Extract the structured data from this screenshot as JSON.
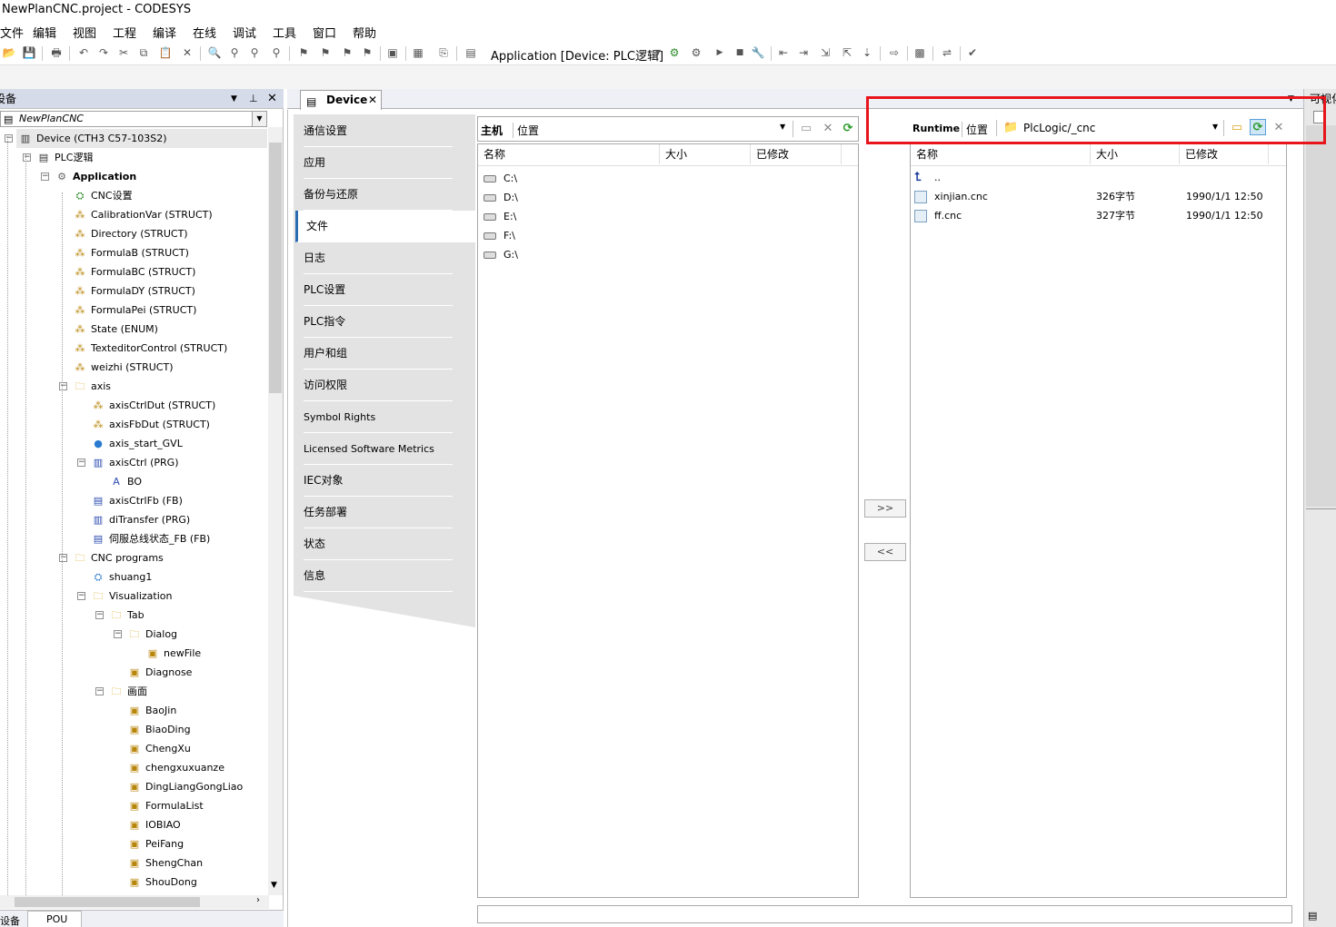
{
  "window": {
    "title": "NewPlanCNC.project - CODESYS"
  },
  "menu": [
    "文件",
    "编辑",
    "视图",
    "工程",
    "编译",
    "在线",
    "调试",
    "工具",
    "窗口",
    "帮助"
  ],
  "toolbar": {
    "active_application": "Application [Device: PLC逻辑]"
  },
  "left_panel": {
    "title": "设备",
    "project_combo": "NewPlanCNC",
    "tree": [
      {
        "label": "Device (CTH3 C57-103S2)",
        "icon": "device-icon",
        "level": 0
      },
      {
        "label": "PLC逻辑",
        "icon": "plc-logic-icon",
        "level": 1
      },
      {
        "label": "Application",
        "icon": "application-gear-icon",
        "level": 2
      },
      {
        "label": "CNC设置",
        "icon": "cnc-settings-icon",
        "level": 3
      },
      {
        "label": "CalibrationVar (STRUCT)",
        "icon": "struct-icon",
        "level": 3
      },
      {
        "label": "Directory (STRUCT)",
        "icon": "struct-icon",
        "level": 3
      },
      {
        "label": "FormulaB (STRUCT)",
        "icon": "struct-icon",
        "level": 3
      },
      {
        "label": "FormulaBC (STRUCT)",
        "icon": "struct-icon",
        "level": 3
      },
      {
        "label": "FormulaDY (STRUCT)",
        "icon": "struct-icon",
        "level": 3
      },
      {
        "label": "FormulaPei (STRUCT)",
        "icon": "struct-icon",
        "level": 3
      },
      {
        "label": "State (ENUM)",
        "icon": "enum-icon",
        "level": 3
      },
      {
        "label": "TexteditorControl (STRUCT)",
        "icon": "struct-icon",
        "level": 3
      },
      {
        "label": "weizhi (STRUCT)",
        "icon": "struct-icon",
        "level": 3
      },
      {
        "label": "axis",
        "icon": "folder-icon",
        "level": 3
      },
      {
        "label": "axisCtrlDut (STRUCT)",
        "icon": "struct-icon",
        "level": 4
      },
      {
        "label": "axisFbDut (STRUCT)",
        "icon": "struct-icon",
        "level": 4
      },
      {
        "label": "axis_start_GVL",
        "icon": "gvl-globe-icon",
        "level": 4
      },
      {
        "label": "axisCtrl (PRG)",
        "icon": "program-icon",
        "level": 4
      },
      {
        "label": "BO",
        "icon": "action-icon",
        "level": 5
      },
      {
        "label": "axisCtrlFb (FB)",
        "icon": "function-block-icon",
        "level": 4
      },
      {
        "label": "diTransfer (PRG)",
        "icon": "program-icon",
        "level": 4
      },
      {
        "label": "伺服总线状态_FB (FB)",
        "icon": "function-block-icon",
        "level": 4
      },
      {
        "label": "CNC programs",
        "icon": "folder-icon",
        "level": 3
      },
      {
        "label": "shuang1",
        "icon": "cnc-program-icon",
        "level": 4
      },
      {
        "label": "Visualization",
        "icon": "folder-icon",
        "level": 4
      },
      {
        "label": "Tab",
        "icon": "folder-icon",
        "level": 5
      },
      {
        "label": "Dialog",
        "icon": "folder-icon",
        "level": 6
      },
      {
        "label": "newFile",
        "icon": "visualization-icon",
        "level": 7
      },
      {
        "label": "Diagnose",
        "icon": "visualization-icon",
        "level": 6
      },
      {
        "label": "画面",
        "icon": "folder-icon",
        "level": 5
      },
      {
        "label": "BaoJin",
        "icon": "visualization-icon",
        "level": 6
      },
      {
        "label": "BiaoDing",
        "icon": "visualization-icon",
        "level": 6
      },
      {
        "label": "ChengXu",
        "icon": "visualization-icon",
        "level": 6
      },
      {
        "label": "chengxuxuanze",
        "icon": "visualization-icon",
        "level": 6
      },
      {
        "label": "DingLiangGongLiao",
        "icon": "visualization-icon",
        "level": 6
      },
      {
        "label": "FormulaList",
        "icon": "visualization-icon",
        "level": 6
      },
      {
        "label": "IOBIAO",
        "icon": "visualization-icon",
        "level": 6
      },
      {
        "label": "PeiFang",
        "icon": "visualization-icon",
        "level": 6
      },
      {
        "label": "ShengChan",
        "icon": "visualization-icon",
        "level": 6
      },
      {
        "label": "ShouDong",
        "icon": "visualization-icon",
        "level": 6
      }
    ],
    "bottom_tabs": [
      "设备",
      "POU"
    ]
  },
  "editor": {
    "tab_label": "Device",
    "nav_items": [
      "通信设置",
      "应用",
      "备份与还原",
      "文件",
      "日志",
      "PLC设置",
      "PLC指令",
      "用户和组",
      "访问权限",
      "Symbol Rights",
      "Licensed Software Metrics",
      "IEC对象",
      "任务部署",
      "状态",
      "信息"
    ],
    "active_nav": "文件",
    "host": {
      "label": "主机",
      "location_label": "位置",
      "location_value": "",
      "columns": [
        "名称",
        "大小",
        "已修改"
      ],
      "drives": [
        "C:\\",
        "D:\\",
        "E:\\",
        "F:\\",
        "G:\\"
      ]
    },
    "runtime": {
      "label": "Runtime",
      "location_label": "位置",
      "location_value": "PlcLogic/_cnc",
      "columns": [
        "名称",
        "大小",
        "已修改"
      ],
      "parent": "..",
      "files": [
        {
          "name": "xinjian.cnc",
          "size": "326字节",
          "modified": "1990/1/1 12:50"
        },
        {
          "name": "ff.cnc",
          "size": "327字节",
          "modified": "1990/1/1 12:50"
        }
      ]
    },
    "copy_to_runtime": ">>",
    "copy_to_host": "<<"
  },
  "right_panel": {
    "title": "可视化"
  },
  "colors": {
    "highlight_box": "#e8141b",
    "panel_header": "#d6dbe9",
    "active_nav_accent": "#2b6cb0"
  }
}
